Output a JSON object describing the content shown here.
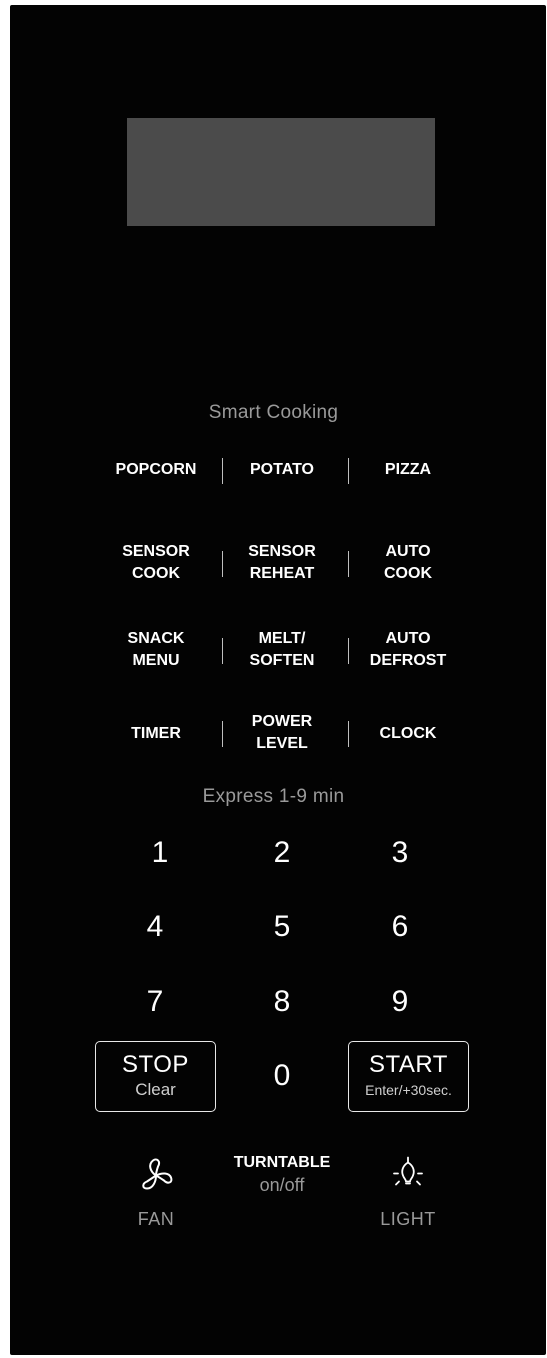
{
  "display": {},
  "smart_cooking": {
    "title": "Smart Cooking",
    "rows": [
      [
        {
          "l1": "POPCORN",
          "l2": ""
        },
        {
          "l1": "POTATO",
          "l2": ""
        },
        {
          "l1": "PIZZA",
          "l2": ""
        }
      ],
      [
        {
          "l1": "SENSOR",
          "l2": "COOK"
        },
        {
          "l1": "SENSOR",
          "l2": "REHEAT"
        },
        {
          "l1": "AUTO",
          "l2": "COOK"
        }
      ],
      [
        {
          "l1": "SNACK",
          "l2": "MENU"
        },
        {
          "l1": "MELT/",
          "l2": "SOFTEN"
        },
        {
          "l1": "AUTO",
          "l2": "DEFROST"
        }
      ],
      [
        {
          "l1": "TIMER",
          "l2": ""
        },
        {
          "l1": "POWER",
          "l2": "LEVEL"
        },
        {
          "l1": "CLOCK",
          "l2": ""
        }
      ]
    ]
  },
  "express": {
    "title": "Express 1-9 min"
  },
  "keypad": {
    "digits": [
      "1",
      "2",
      "3",
      "4",
      "5",
      "6",
      "7",
      "8",
      "9",
      "0"
    ]
  },
  "stop": {
    "main": "STOP",
    "sub": "Clear"
  },
  "start": {
    "main": "START",
    "sub": "Enter/+30sec."
  },
  "controls": {
    "fan_icon": "fan-icon",
    "fan_label": "FAN",
    "turntable_main": "TURNTABLE",
    "turntable_sub": "on/off",
    "light_icon": "lightbulb-icon",
    "light_label": "LIGHT"
  },
  "colors": {
    "panel": "#030303",
    "display": "#4b4b4b",
    "label_gray": "#9a9a9a",
    "text": "#ffffff"
  }
}
